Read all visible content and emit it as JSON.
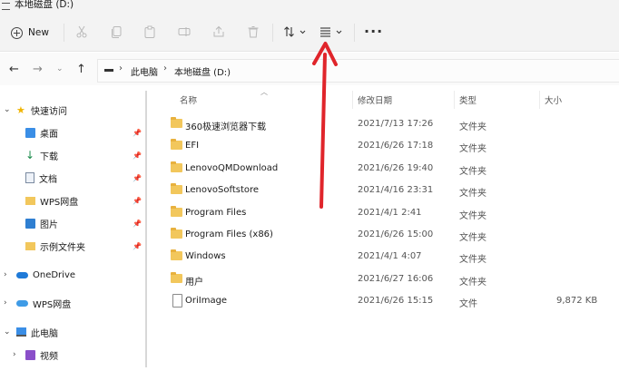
{
  "window": {
    "title": "本地磁盘 (D:)"
  },
  "toolbar": {
    "new_label": "New",
    "icons": [
      "cut-icon",
      "copy-icon",
      "paste-icon",
      "rename-icon",
      "share-icon",
      "delete-icon",
      "sort-icon",
      "view-icon",
      "more-icon"
    ],
    "sort_caret": "⌄",
    "view_caret": "⌄",
    "more_label": "···"
  },
  "address": {
    "back": "←",
    "forward": "→",
    "recent": "⌄",
    "up": "↑",
    "separator": "›",
    "breadcrumb": [
      "此电脑",
      "本地磁盘 (D:)"
    ]
  },
  "sidebar": {
    "quick_access": "快速访问",
    "items": [
      {
        "label": "桌面",
        "icon": "desktop-icon",
        "pinned": true
      },
      {
        "label": "下载",
        "icon": "download-icon",
        "pinned": true
      },
      {
        "label": "文档",
        "icon": "document-icon",
        "pinned": true
      },
      {
        "label": "WPS网盘",
        "icon": "folder-icon",
        "pinned": true
      },
      {
        "label": "图片",
        "icon": "pictures-icon",
        "pinned": true
      },
      {
        "label": "示例文件夹",
        "icon": "folder-icon",
        "pinned": true
      }
    ],
    "onedrive": "OneDrive",
    "wps": "WPS网盘",
    "this_pc": "此电脑",
    "videos": "视频"
  },
  "columns": {
    "name": "名称",
    "date": "修改日期",
    "type": "类型",
    "size": "大小"
  },
  "files": [
    {
      "name": "360极速浏览器下载",
      "date": "2021/7/13 17:26",
      "type": "文件夹",
      "size": "",
      "kind": "folder"
    },
    {
      "name": "EFI",
      "date": "2021/6/26 17:18",
      "type": "文件夹",
      "size": "",
      "kind": "folder"
    },
    {
      "name": "LenovoQMDownload",
      "date": "2021/6/26 19:40",
      "type": "文件夹",
      "size": "",
      "kind": "folder"
    },
    {
      "name": "LenovoSoftstore",
      "date": "2021/4/16 23:31",
      "type": "文件夹",
      "size": "",
      "kind": "folder"
    },
    {
      "name": "Program Files",
      "date": "2021/4/1 2:41",
      "type": "文件夹",
      "size": "",
      "kind": "folder"
    },
    {
      "name": "Program Files (x86)",
      "date": "2021/6/26 15:00",
      "type": "文件夹",
      "size": "",
      "kind": "folder"
    },
    {
      "name": "Windows",
      "date": "2021/4/1 4:07",
      "type": "文件夹",
      "size": "",
      "kind": "folder"
    },
    {
      "name": "用户",
      "date": "2021/6/27 16:06",
      "type": "文件夹",
      "size": "",
      "kind": "folder"
    },
    {
      "name": "OriImage",
      "date": "2021/6/26 15:15",
      "type": "文件",
      "size": "9,872 KB",
      "kind": "file"
    }
  ],
  "colors": {
    "accent": "#0067c0",
    "arrow": "#e0252b",
    "folder": "#f2c75c"
  }
}
